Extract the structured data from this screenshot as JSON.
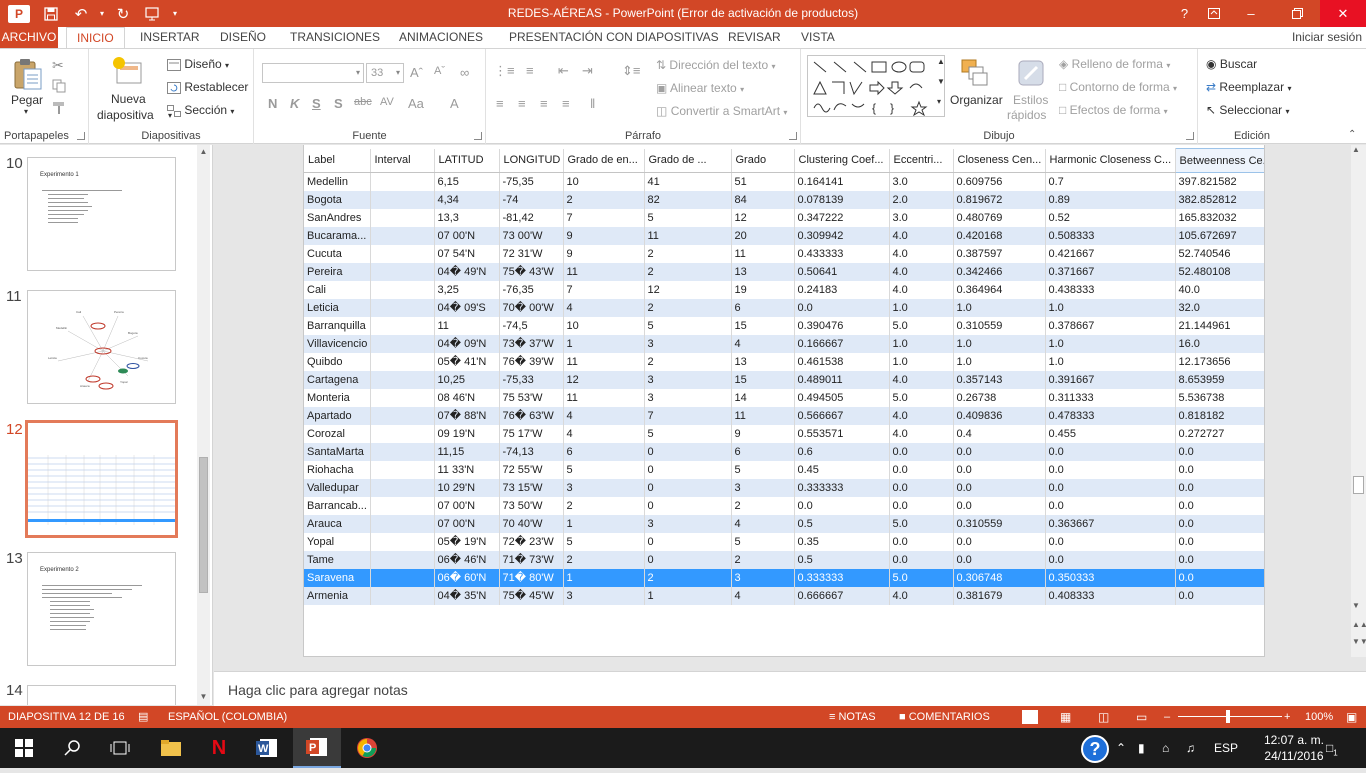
{
  "window": {
    "title": "REDES-AÉREAS -  PowerPoint (Error de activación de productos)",
    "help": "?",
    "app_icon": "P"
  },
  "tabs": {
    "archivo": "ARCHIVO",
    "items": [
      "INICIO",
      "INSERTAR",
      "DISEÑO",
      "TRANSICIONES",
      "ANIMACIONES",
      "PRESENTACIÓN CON DIAPOSITIVAS",
      "REVISAR",
      "VISTA"
    ],
    "signin": "Iniciar sesión"
  },
  "ribbon": {
    "portapapeles": {
      "label": "Portapapeles",
      "pegar": "Pegar"
    },
    "diapositivas": {
      "label": "Diapositivas",
      "nueva": "Nueva",
      "nueva2": "diapositiva",
      "diseno": "Diseño",
      "restablecer": "Restablecer",
      "seccion": "Sección"
    },
    "fuente": {
      "label": "Fuente",
      "size": "33"
    },
    "parrafo": {
      "label": "Párrafo",
      "direccion": "Dirección del texto",
      "alinear": "Alinear texto",
      "convertir": "Convertir a SmartArt"
    },
    "dibujo": {
      "label": "Dibujo",
      "organizar": "Organizar",
      "estilos": "Estilos",
      "estilos2": "rápidos",
      "relleno": "Relleno de forma",
      "contorno": "Contorno de forma",
      "efectos": "Efectos de forma"
    },
    "edicion": {
      "label": "Edición",
      "buscar": "Buscar",
      "reemplazar": "Reemplazar",
      "seleccionar": "Seleccionar"
    }
  },
  "thumbnails": [
    {
      "num": "10",
      "title": "Experimento 1"
    },
    {
      "num": "11",
      "title": ""
    },
    {
      "num": "12",
      "title": ""
    },
    {
      "num": "13",
      "title": "Experimento 2"
    },
    {
      "num": "14",
      "title": ""
    }
  ],
  "table": {
    "headers": [
      "Label",
      "Interval",
      "LATITUD",
      "LONGITUD",
      "Grado de en...",
      "Grado de ...",
      "Grado",
      "Clustering Coef...",
      "Eccentri...",
      "Closeness Cen...",
      "Harmonic Closeness C...",
      "Betweenness Ce..."
    ],
    "rows": [
      [
        "Medellin",
        "",
        "6,15",
        "-75,35",
        "10",
        "41",
        "51",
        "0.164141",
        "3.0",
        "0.609756",
        "0.7",
        "397.821582"
      ],
      [
        "Bogota",
        "",
        "4,34",
        "-74",
        "2",
        "82",
        "84",
        "0.078139",
        "2.0",
        "0.819672",
        "0.89",
        "382.852812"
      ],
      [
        "SanAndres",
        "",
        "13,3",
        "-81,42",
        "7",
        "5",
        "12",
        "0.347222",
        "3.0",
        "0.480769",
        "0.52",
        "165.832032"
      ],
      [
        "Bucarama...",
        "",
        "07 00'N",
        "73 00'W",
        "9",
        "11",
        "20",
        "0.309942",
        "4.0",
        "0.420168",
        "0.508333",
        "105.672697"
      ],
      [
        "Cucuta",
        "",
        "07 54'N",
        "72 31'W",
        "9",
        "2",
        "11",
        "0.433333",
        "4.0",
        "0.387597",
        "0.421667",
        "52.740546"
      ],
      [
        "Pereira",
        "",
        "04� 49'N",
        "75� 43'W",
        "11",
        "2",
        "13",
        "0.50641",
        "4.0",
        "0.342466",
        "0.371667",
        "52.480108"
      ],
      [
        "Cali",
        "",
        "3,25",
        "-76,35",
        "7",
        "12",
        "19",
        "0.24183",
        "4.0",
        "0.364964",
        "0.438333",
        "40.0"
      ],
      [
        "Leticia",
        "",
        "04� 09'S",
        "70� 00'W",
        "4",
        "2",
        "6",
        "0.0",
        "1.0",
        "1.0",
        "1.0",
        "32.0"
      ],
      [
        "Barranquilla",
        "",
        "11",
        "-74,5",
        "10",
        "5",
        "15",
        "0.390476",
        "5.0",
        "0.310559",
        "0.378667",
        "21.144961"
      ],
      [
        "Villavicencio",
        "",
        "04� 09'N",
        "73� 37'W",
        "1",
        "3",
        "4",
        "0.166667",
        "1.0",
        "1.0",
        "1.0",
        "16.0"
      ],
      [
        "Quibdo",
        "",
        "05� 41'N",
        "76� 39'W",
        "11",
        "2",
        "13",
        "0.461538",
        "1.0",
        "1.0",
        "1.0",
        "12.173656"
      ],
      [
        "Cartagena",
        "",
        "10,25",
        "-75,33",
        "12",
        "3",
        "15",
        "0.489011",
        "4.0",
        "0.357143",
        "0.391667",
        "8.653959"
      ],
      [
        "Monteria",
        "",
        "08 46'N",
        "75 53'W",
        "11",
        "3",
        "14",
        "0.494505",
        "5.0",
        "0.26738",
        "0.311333",
        "5.536738"
      ],
      [
        "Apartado",
        "",
        "07� 88'N",
        "76� 63'W",
        "4",
        "7",
        "11",
        "0.566667",
        "4.0",
        "0.409836",
        "0.478333",
        "0.818182"
      ],
      [
        "Corozal",
        "",
        "09 19'N",
        "75 17'W",
        "4",
        "5",
        "9",
        "0.553571",
        "4.0",
        "0.4",
        "0.455",
        "0.272727"
      ],
      [
        "SantaMarta",
        "",
        "11,15",
        "-74,13",
        "6",
        "0",
        "6",
        "0.6",
        "0.0",
        "0.0",
        "0.0",
        "0.0"
      ],
      [
        "Riohacha",
        "",
        "11 33'N",
        "72 55'W",
        "5",
        "0",
        "5",
        "0.45",
        "0.0",
        "0.0",
        "0.0",
        "0.0"
      ],
      [
        "Valledupar",
        "",
        "10 29'N",
        "73 15'W",
        "3",
        "0",
        "3",
        "0.333333",
        "0.0",
        "0.0",
        "0.0",
        "0.0"
      ],
      [
        "Barrancab...",
        "",
        "07 00'N",
        "73 50'W",
        "2",
        "0",
        "2",
        "0.0",
        "0.0",
        "0.0",
        "0.0",
        "0.0"
      ],
      [
        "Arauca",
        "",
        "07 00'N",
        "70 40'W",
        "1",
        "3",
        "4",
        "0.5",
        "5.0",
        "0.310559",
        "0.363667",
        "0.0"
      ],
      [
        "Yopal",
        "",
        "05� 19'N",
        "72� 23'W",
        "5",
        "0",
        "5",
        "0.35",
        "0.0",
        "0.0",
        "0.0",
        "0.0"
      ],
      [
        "Tame",
        "",
        "06� 46'N",
        "71� 73'W",
        "2",
        "0",
        "2",
        "0.5",
        "0.0",
        "0.0",
        "0.0",
        "0.0"
      ],
      [
        "Saravena",
        "",
        "06� 60'N",
        "71� 80'W",
        "1",
        "2",
        "3",
        "0.333333",
        "5.0",
        "0.306748",
        "0.350333",
        "0.0"
      ],
      [
        "Armenia",
        "",
        "04� 35'N",
        "75� 45'W",
        "3",
        "1",
        "4",
        "0.666667",
        "4.0",
        "0.381679",
        "0.408333",
        "0.0"
      ]
    ],
    "selected_row": "Saravena"
  },
  "notes": {
    "placeholder": "Haga clic para agregar notas"
  },
  "status": {
    "slide": "DIAPOSITIVA 12 DE 16",
    "language": "ESPAÑOL (COLOMBIA)",
    "notas": "NOTAS",
    "comentarios": "COMENTARIOS",
    "zoom": "100%"
  },
  "taskbar": {
    "lang": "ESP",
    "time": "12:07 a. m.",
    "date": "24/11/2016",
    "help": "?",
    "notifications": "1"
  },
  "colors": {
    "accent": "#d24726",
    "selection": "#3399ff",
    "alt_row": "#dfe9f7"
  }
}
